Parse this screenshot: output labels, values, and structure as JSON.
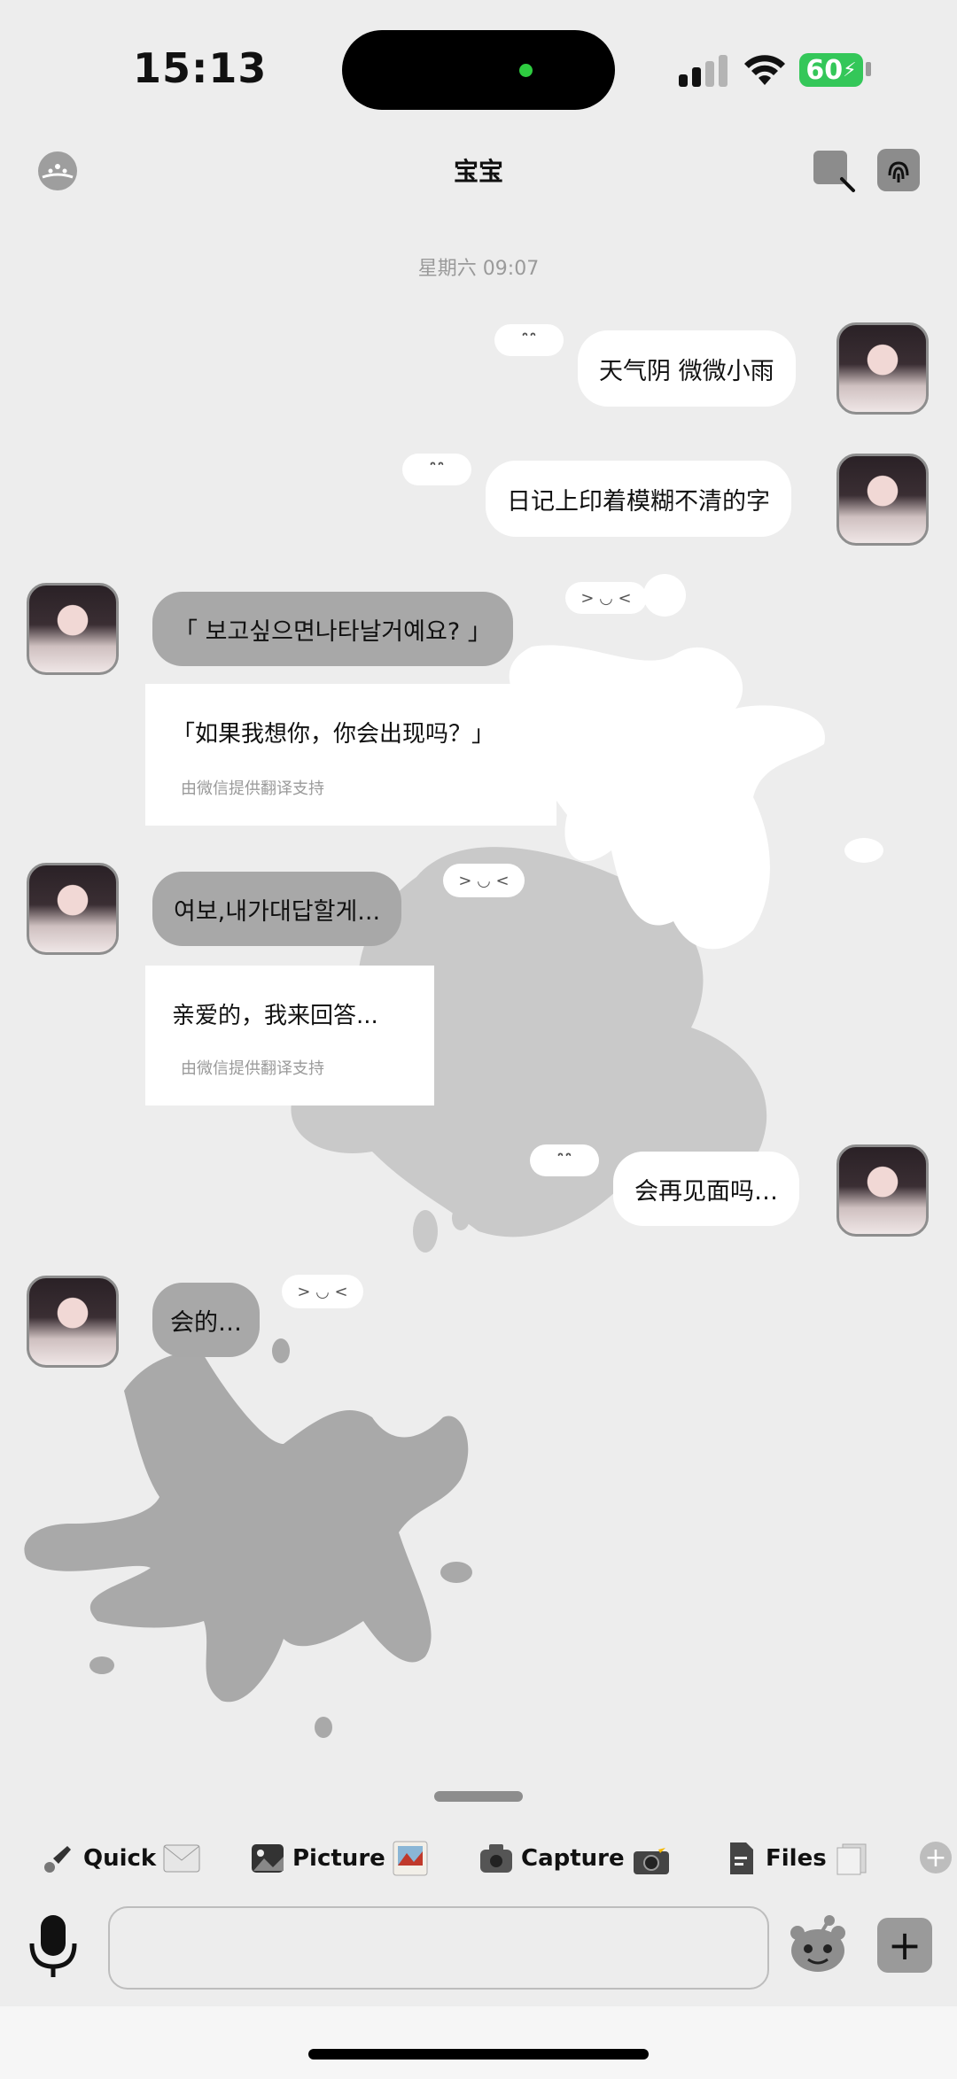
{
  "status_bar": {
    "time": "15:13",
    "battery": "60"
  },
  "header": {
    "title": "宝宝"
  },
  "chat": {
    "date": "星期六 09:07",
    "messages": [
      {
        "text": "天气阴 微微小雨",
        "emote": "ˆ̑̑ˆ̑̑"
      },
      {
        "text": "日记上印着模糊不清的字",
        "emote": "ˆ̑̑ˆ̑̑"
      },
      {
        "text": "「 보고싶으면나타날거예요? 」",
        "emote": "> ◡ <",
        "translation": "「如果我想你，你会出现吗？」",
        "translation_note": "由微信提供翻译支持"
      },
      {
        "text": "여보,내가대답할게...",
        "emote": "> ◡ <",
        "translation": "亲爱的，我来回答...",
        "translation_note": "由微信提供翻译支持"
      },
      {
        "text": "会再见面吗…",
        "emote": "ˆ̑̑ˆ̑̑"
      },
      {
        "text": "会的…",
        "emote": "> ◡ <"
      }
    ]
  },
  "toolbar": {
    "quick": "Quick",
    "picture": "Picture",
    "capture": "Capture",
    "files": "Files"
  },
  "input": {
    "placeholder": ""
  }
}
